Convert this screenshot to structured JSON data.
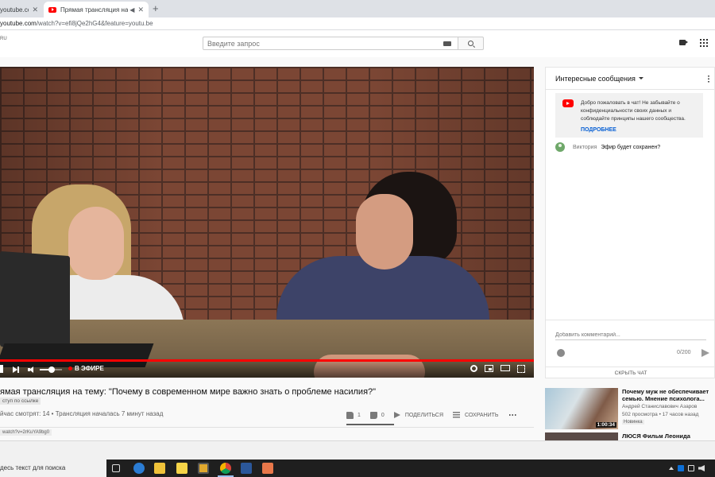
{
  "browser": {
    "tabs": [
      {
        "title": "youtube.com"
      },
      {
        "title": "Прямая трансляция на тем"
      }
    ],
    "url_host": "youtube.com",
    "url_rest": "/watch?v=efi8jQe2hG4&feature=youtu.be"
  },
  "youtube": {
    "logo_tail": "RU",
    "search_placeholder": "Введите запрос"
  },
  "player": {
    "live_label": "В ЭФИРЕ",
    "progress_fraction": 1.0,
    "volume_fraction": 0.55
  },
  "chat": {
    "header": "Интересные сообщения",
    "welcome_text": "Добро пожаловать в чат! Не забывайте о конфиденциальности своих данных и соблюдайте принципы нашего сообщества.",
    "learn_more": "ПОДРОБНЕЕ",
    "messages": [
      {
        "author": "Виктория",
        "text": "Эфир будет сохранен?"
      }
    ],
    "input_placeholder": "Добавить комментарий...",
    "char_count": "0/200",
    "hide_chat": "СКРЫТЬ ЧАТ"
  },
  "video": {
    "title": "ямая трансляция на тему: \"Почему в современном мире важно знать о проблеме насилия?\"",
    "access": "ступ по ссылке",
    "views": "йчас смотрят: 14 • Трансляция началась 7 минут назад",
    "likes": "1",
    "dislikes": "0",
    "share": "ПОДЕЛИТЬСЯ",
    "save": "СОХРАНИТЬ",
    "link_stub": "watch?v=2rKuYA9bg0"
  },
  "recommendations": [
    {
      "title": "Почему муж не обеспечивает семью. Мнение психолога...",
      "channel": "Андрей Станиславович Азаров",
      "meta": "502 просмотра • 17 часов назад",
      "badge": "Новинка",
      "duration": "1:00:34"
    },
    {
      "title": "ЛЮСЯ Фильм Леонида"
    }
  ],
  "taskbar": {
    "search_text": "десь текст для поиска"
  },
  "colors": {
    "youtube_red": "#ff0000",
    "link_blue": "#065fd4",
    "taskbar": "#1f1f1f"
  }
}
